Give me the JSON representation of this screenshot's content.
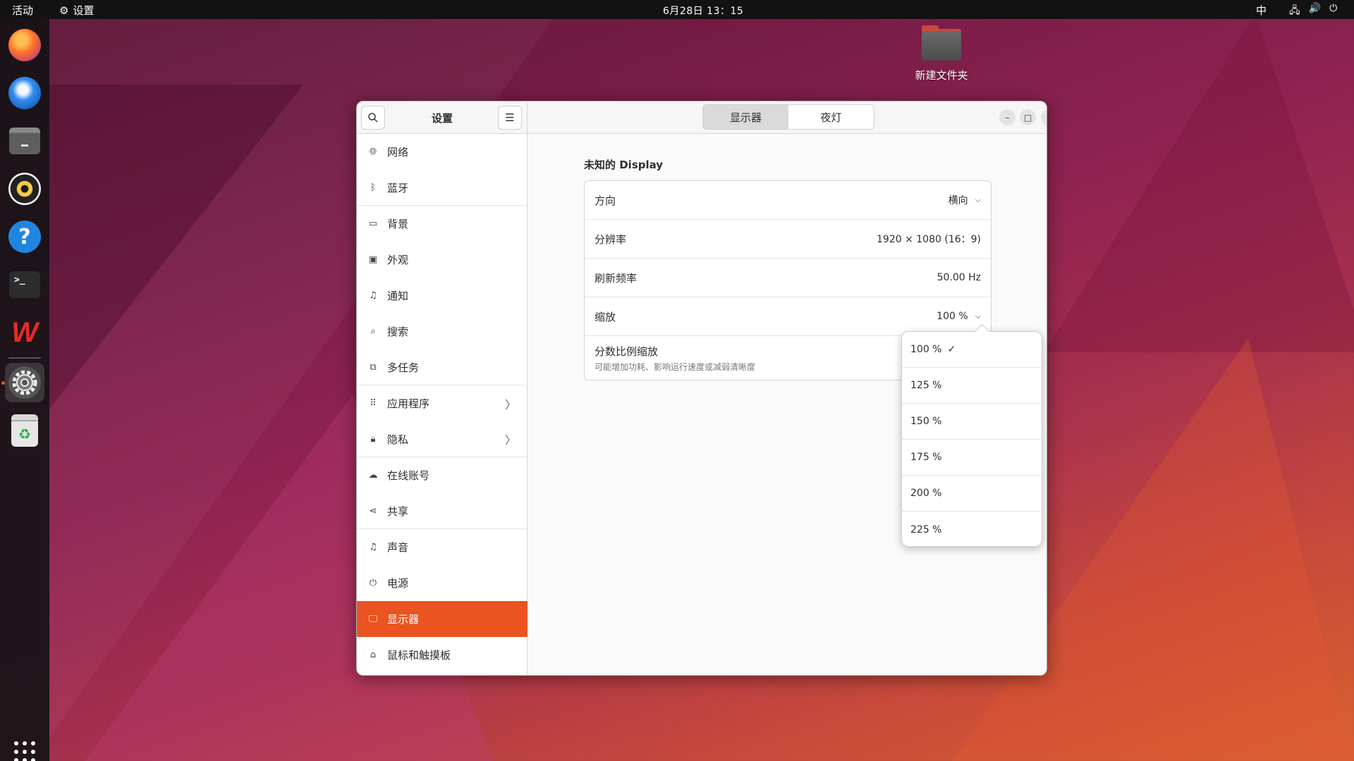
{
  "topbar": {
    "activities": "活动",
    "app_name": "设置",
    "clock": "6月28日 13：15",
    "input_method": "中"
  },
  "dock": {
    "items": [
      "firefox",
      "thunderbird",
      "files",
      "rhythmbox",
      "help",
      "terminal",
      "wps-office",
      "settings",
      "trash"
    ],
    "active": "settings"
  },
  "desktop": {
    "folder_label": "新建文件夹"
  },
  "window": {
    "sidebar_title": "设置",
    "sidebar_items": [
      {
        "label": "网络",
        "icon": "globe-icon"
      },
      {
        "label": "蓝牙",
        "icon": "bluetooth-icon"
      },
      {
        "label": "背景",
        "icon": "background-icon"
      },
      {
        "label": "外观",
        "icon": "appearance-icon"
      },
      {
        "label": "通知",
        "icon": "bell-icon"
      },
      {
        "label": "搜索",
        "icon": "search-icon"
      },
      {
        "label": "多任务",
        "icon": "multitask-icon"
      },
      {
        "label": "应用程序",
        "icon": "apps-icon"
      },
      {
        "label": "隐私",
        "icon": "lock-icon"
      },
      {
        "label": "在线账号",
        "icon": "cloud-icon"
      },
      {
        "label": "共享",
        "icon": "share-icon"
      },
      {
        "label": "声音",
        "icon": "music-icon"
      },
      {
        "label": "电源",
        "icon": "power-icon"
      },
      {
        "label": "显示器",
        "icon": "display-icon"
      },
      {
        "label": "鼠标和触摸板",
        "icon": "mouse-icon"
      }
    ],
    "selected_item": "显示器",
    "tabs": [
      "显示器",
      "夜灯"
    ],
    "active_tab": "显示器",
    "display_name": "未知的 Display",
    "rows": {
      "orientation_label": "方向",
      "orientation_value": "横向",
      "resolution_label": "分辨率",
      "resolution_value": "1920 × 1080 (16：9)",
      "refresh_label": "刷新频率",
      "refresh_value": "50.00 Hz",
      "scale_label": "缩放",
      "scale_value": "100 %",
      "fractional_label": "分数比例缩放",
      "fractional_sub": "可能增加功耗、影响运行速度或减弱清晰度"
    },
    "scale_options": [
      "100 %",
      "125 %",
      "150 %",
      "175 %",
      "200 %",
      "225 %"
    ],
    "scale_selected": "100 %",
    "accent_color": "#e95420"
  }
}
